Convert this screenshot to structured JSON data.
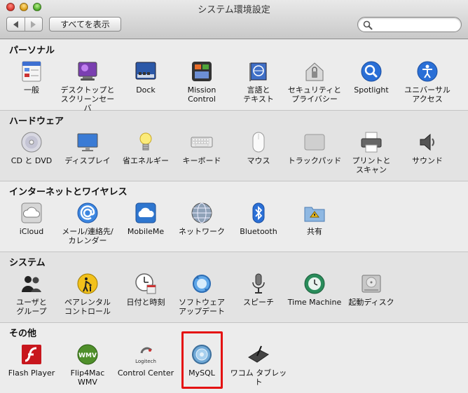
{
  "window": {
    "title": "システム環境設定"
  },
  "toolbar": {
    "show_all_label": "すべてを表示",
    "search_placeholder": ""
  },
  "sections": [
    {
      "title": "パーソナル",
      "items": [
        {
          "label": "一般",
          "icon": "general-icon"
        },
        {
          "label": "デスクトップと\nスクリーンセーバ",
          "icon": "desktop-icon"
        },
        {
          "label": "Dock",
          "icon": "dock-icon"
        },
        {
          "label": "Mission\nControl",
          "icon": "mission-control-icon"
        },
        {
          "label": "言語と\nテキスト",
          "icon": "language-icon"
        },
        {
          "label": "セキュリティと\nプライバシー",
          "icon": "security-icon"
        },
        {
          "label": "Spotlight",
          "icon": "spotlight-icon"
        },
        {
          "label": "ユニバーサル\nアクセス",
          "icon": "universal-access-icon"
        }
      ]
    },
    {
      "title": "ハードウェア",
      "items": [
        {
          "label": "CD と DVD",
          "icon": "cd-dvd-icon"
        },
        {
          "label": "ディスプレイ",
          "icon": "display-icon"
        },
        {
          "label": "省エネルギー",
          "icon": "energy-saver-icon"
        },
        {
          "label": "キーボード",
          "icon": "keyboard-icon"
        },
        {
          "label": "マウス",
          "icon": "mouse-icon"
        },
        {
          "label": "トラックパッド",
          "icon": "trackpad-icon"
        },
        {
          "label": "プリントと\nスキャン",
          "icon": "printer-icon"
        },
        {
          "label": "サウンド",
          "icon": "sound-icon"
        }
      ]
    },
    {
      "title": "インターネットとワイヤレス",
      "items": [
        {
          "label": "iCloud",
          "icon": "icloud-icon"
        },
        {
          "label": "メール/連絡先/\nカレンダー",
          "icon": "mail-icon"
        },
        {
          "label": "MobileMe",
          "icon": "mobileme-icon"
        },
        {
          "label": "ネットワーク",
          "icon": "network-icon"
        },
        {
          "label": "Bluetooth",
          "icon": "bluetooth-icon"
        },
        {
          "label": "共有",
          "icon": "sharing-icon"
        }
      ]
    },
    {
      "title": "システム",
      "items": [
        {
          "label": "ユーザと\nグループ",
          "icon": "users-icon"
        },
        {
          "label": "ペアレンタル\nコントロール",
          "icon": "parental-controls-icon"
        },
        {
          "label": "日付と時刻",
          "icon": "date-time-icon"
        },
        {
          "label": "ソフトウェア\nアップデート",
          "icon": "software-update-icon"
        },
        {
          "label": "スピーチ",
          "icon": "speech-icon"
        },
        {
          "label": "Time Machine",
          "icon": "time-machine-icon"
        },
        {
          "label": "起動ディスク",
          "icon": "startup-disk-icon"
        }
      ]
    },
    {
      "title": "その他",
      "items": [
        {
          "label": "Flash Player",
          "icon": "flash-player-icon"
        },
        {
          "label": "Flip4Mac\nWMV",
          "icon": "flip4mac-icon"
        },
        {
          "label": "Control Center",
          "icon": "logitech-icon",
          "badge": "Logitech"
        },
        {
          "label": "MySQL",
          "icon": "mysql-icon"
        },
        {
          "label": "ワコム タブレット",
          "icon": "wacom-tablet-icon"
        }
      ]
    }
  ],
  "colors": {
    "highlight": "#e51212",
    "accent": "#2a6fd6"
  }
}
